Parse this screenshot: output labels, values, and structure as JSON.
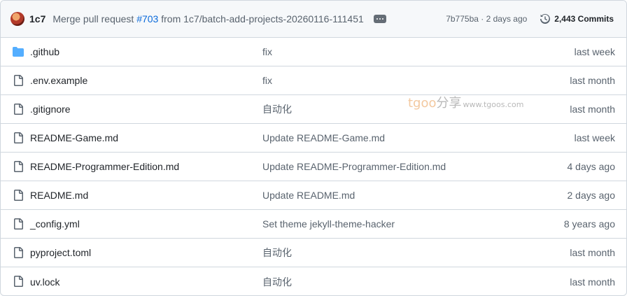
{
  "commit": {
    "author": "1c7",
    "message_prefix": "Merge pull request ",
    "pr_number": "#703",
    "message_suffix": " from 1c7/batch-add-projects-20260116-111451",
    "sha_time": "7b775ba · 2 days ago",
    "commits_count": "2,443 Commits"
  },
  "files": [
    {
      "name": ".github",
      "type": "folder",
      "message": "fix",
      "age": "last week"
    },
    {
      "name": ".env.example",
      "type": "file",
      "message": "fix",
      "age": "last month"
    },
    {
      "name": ".gitignore",
      "type": "file",
      "message": "自动化",
      "age": "last month"
    },
    {
      "name": "README-Game.md",
      "type": "file",
      "message": "Update README-Game.md",
      "age": "last week"
    },
    {
      "name": "README-Programmer-Edition.md",
      "type": "file",
      "message": "Update README-Programmer-Edition.md",
      "age": "4 days ago"
    },
    {
      "name": "README.md",
      "type": "file",
      "message": "Update README.md",
      "age": "2 days ago"
    },
    {
      "name": "_config.yml",
      "type": "file",
      "message": "Set theme jekyll-theme-hacker",
      "age": "8 years ago"
    },
    {
      "name": "pyproject.toml",
      "type": "file",
      "message": "自动化",
      "age": "last month"
    },
    {
      "name": "uv.lock",
      "type": "file",
      "message": "自动化",
      "age": "last month"
    }
  ],
  "watermark": {
    "brand": "tgoo",
    "cn": "分享",
    "url": "www.tgoos.com"
  },
  "colors": {
    "link": "#0969da",
    "folder": "#54aeff",
    "muted": "#59636e"
  }
}
